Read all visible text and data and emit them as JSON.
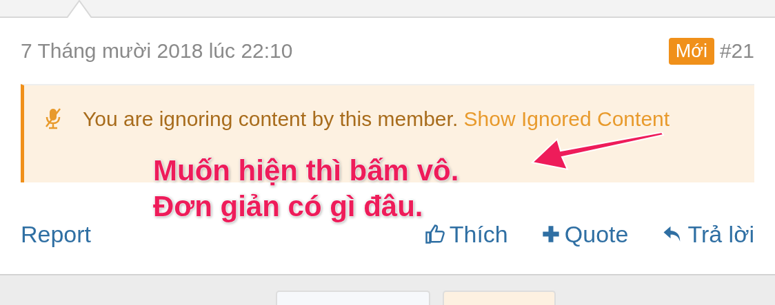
{
  "post": {
    "date": "7 Tháng mười 2018 lúc 22:10",
    "badge": "Mới",
    "number": "#21"
  },
  "notice": {
    "text": "You are ignoring content by this member.",
    "link": "Show Ignored Content"
  },
  "annotation": {
    "lines": [
      "Muốn hiện thì bấm vô.",
      "Đơn giản có gì đâu."
    ]
  },
  "actions": {
    "report": "Report",
    "buttons": [
      {
        "kind": "like",
        "label": "Thích"
      },
      {
        "kind": "quote",
        "label": "Quote"
      },
      {
        "kind": "reply",
        "label": "Trả lời"
      }
    ]
  }
}
